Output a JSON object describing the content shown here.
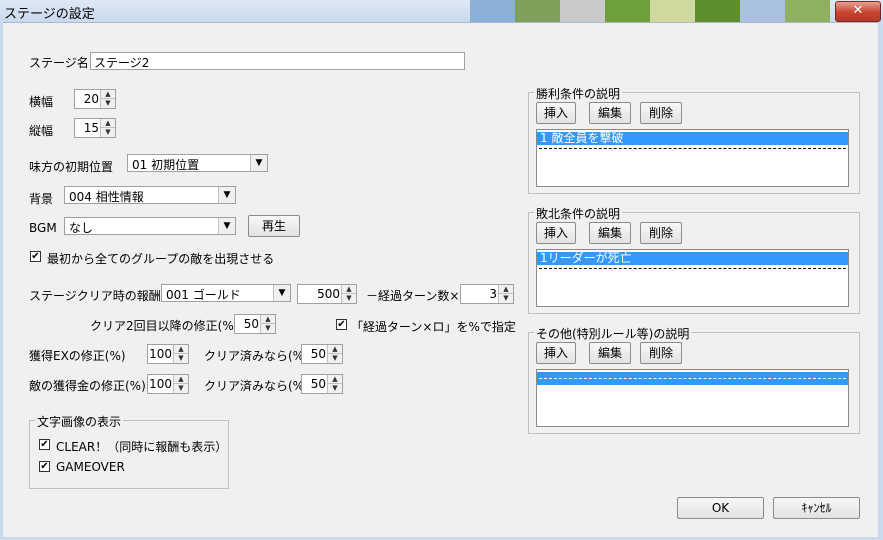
{
  "window": {
    "title": "ステージの設定",
    "close": "✕"
  },
  "stage_name": {
    "label": "ステージ名",
    "value": "ステージ2"
  },
  "width": {
    "label": "横幅",
    "value": "20"
  },
  "height": {
    "label": "縦幅",
    "value": "15"
  },
  "ally_start": {
    "label": "味方の初期位置",
    "value": "01 初期位置"
  },
  "background": {
    "label": "背景",
    "value": "004 相性情報"
  },
  "bgm": {
    "label": "BGM",
    "value": "なし",
    "play_button": "再生"
  },
  "show_all_groups": {
    "label": "最初から全てのグループの敵を出現させる",
    "checked": true
  },
  "reward": {
    "label": "ステージクリア時の報酬",
    "item": "001 ゴールド",
    "amount": "500",
    "minus_label": "－経過ターン数×",
    "multiplier": "3"
  },
  "second_clear": {
    "label": "クリア2回目以降の修正(%)",
    "value": "50",
    "percent_check_label": "「経過ターン×ロ」を%で指定",
    "percent_checked": true
  },
  "exp_mod": {
    "label": "獲得EXの修正(%)",
    "value": "100",
    "cleared_label": "クリア済みなら(%)",
    "cleared_value": "50"
  },
  "gold_mod": {
    "label": "敵の獲得金の修正(%)",
    "value": "100",
    "cleared_label": "クリア済みなら(%)",
    "cleared_value": "50"
  },
  "text_image": {
    "title": "文字画像の表示",
    "clear": {
      "label": "CLEAR！（同時に報酬も表示）",
      "checked": true
    },
    "gameover": {
      "label": "GAMEOVER",
      "checked": true
    }
  },
  "buttons_labels": {
    "insert": "挿入",
    "edit": "編集",
    "delete": "削除"
  },
  "victory": {
    "title": "勝利条件の説明",
    "items": [
      "1 敵全員を撃破"
    ]
  },
  "defeat": {
    "title": "敗北条件の説明",
    "items": [
      "1リーダーが死亡"
    ]
  },
  "other": {
    "title": "その他(特別ルール等)の説明",
    "items": []
  },
  "footer": {
    "ok": "OK",
    "cancel": "ｷｬﾝｾﾙ"
  },
  "colors": {
    "selection": "#3399ff",
    "close": "#c7432f",
    "titlebar": "#c9d9ee"
  },
  "icons": {
    "check": "✔",
    "spin_up": "▲",
    "spin_down": "▼",
    "combo": "▼"
  }
}
